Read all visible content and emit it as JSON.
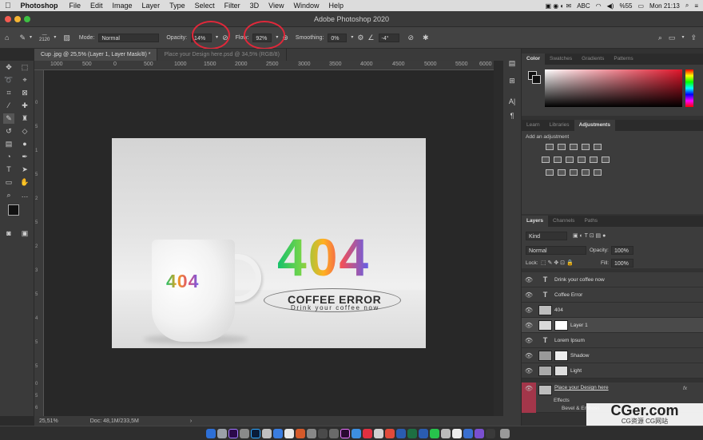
{
  "menubar": {
    "apple": "",
    "app": "Photoshop",
    "items": [
      "File",
      "Edit",
      "Image",
      "Layer",
      "Type",
      "Select",
      "Filter",
      "3D",
      "View",
      "Window",
      "Help"
    ],
    "keyboard": "ABC",
    "battery": "%55",
    "clock": "Mon 21:13"
  },
  "window": {
    "title": "Adobe Photoshop 2020"
  },
  "options": {
    "brush_size": "2120",
    "mode_label": "Mode:",
    "mode_value": "Normal",
    "opacity_label": "Opacity:",
    "opacity_value": "14%",
    "flow_label": "Flow:",
    "flow_value": "92%",
    "smoothing_label": "Smoothing:",
    "smoothing_value": "0%",
    "angle_value": "-4°"
  },
  "tabs": [
    {
      "label": "Cup .jpg @ 25,5% (Layer 1, Layer Mask/8) *"
    },
    {
      "label": "Place your Design here.psd @ 34,5% (RGB/8)"
    }
  ],
  "ruler_h": [
    "1000",
    "500",
    "0",
    "500",
    "1000",
    "1500",
    "2000",
    "2500",
    "3000",
    "3500",
    "4000",
    "4500",
    "5000",
    "5500",
    "6000"
  ],
  "ruler_v": [
    "0",
    "5",
    "1",
    "5",
    "2",
    "5",
    "2",
    "3",
    "5",
    "4",
    "5",
    "5",
    "0",
    "5",
    "6"
  ],
  "canvas": {
    "mug_text": "404",
    "big_text": "404",
    "error_text": "COFFEE ERROR",
    "sub_text": "Drink your coffee now"
  },
  "status": {
    "zoom": "25,51%",
    "doc": "Doc: 48,1M/233,5M",
    "arrow": "›"
  },
  "color_panel": {
    "tabs": [
      "Color",
      "Swatches",
      "Gradients",
      "Patterns"
    ]
  },
  "adjust_panel": {
    "tabs": [
      "Learn",
      "Libraries",
      "Adjustments"
    ],
    "hint": "Add an adjustment"
  },
  "layers_panel": {
    "tabs": [
      "Layers",
      "Channels",
      "Paths"
    ],
    "kind": "Kind",
    "blend": "Normal",
    "opacity_label": "Opacity:",
    "opacity_value": "100%",
    "lock_label": "Lock:",
    "fill_label": "Fill:",
    "fill_value": "100%",
    "layers": [
      {
        "name": "Drink your coffee now"
      },
      {
        "name": "Coffee Error"
      },
      {
        "name": "404"
      },
      {
        "name": "Layer 1"
      },
      {
        "name": "Lorem Ipsum"
      },
      {
        "name": "Shadow"
      },
      {
        "name": "Light"
      },
      {
        "name": "Place your Design here"
      }
    ],
    "effects": "Effects",
    "bevel": "Bevel & Emboss",
    "fx": "fx"
  },
  "watermark": {
    "big": "CGer.com",
    "small": "CG资源 CG网站"
  },
  "colors": {
    "accent_red": "#e0283a",
    "bg_dark": "#2b2b2b",
    "panel": "#3c3c3c"
  }
}
